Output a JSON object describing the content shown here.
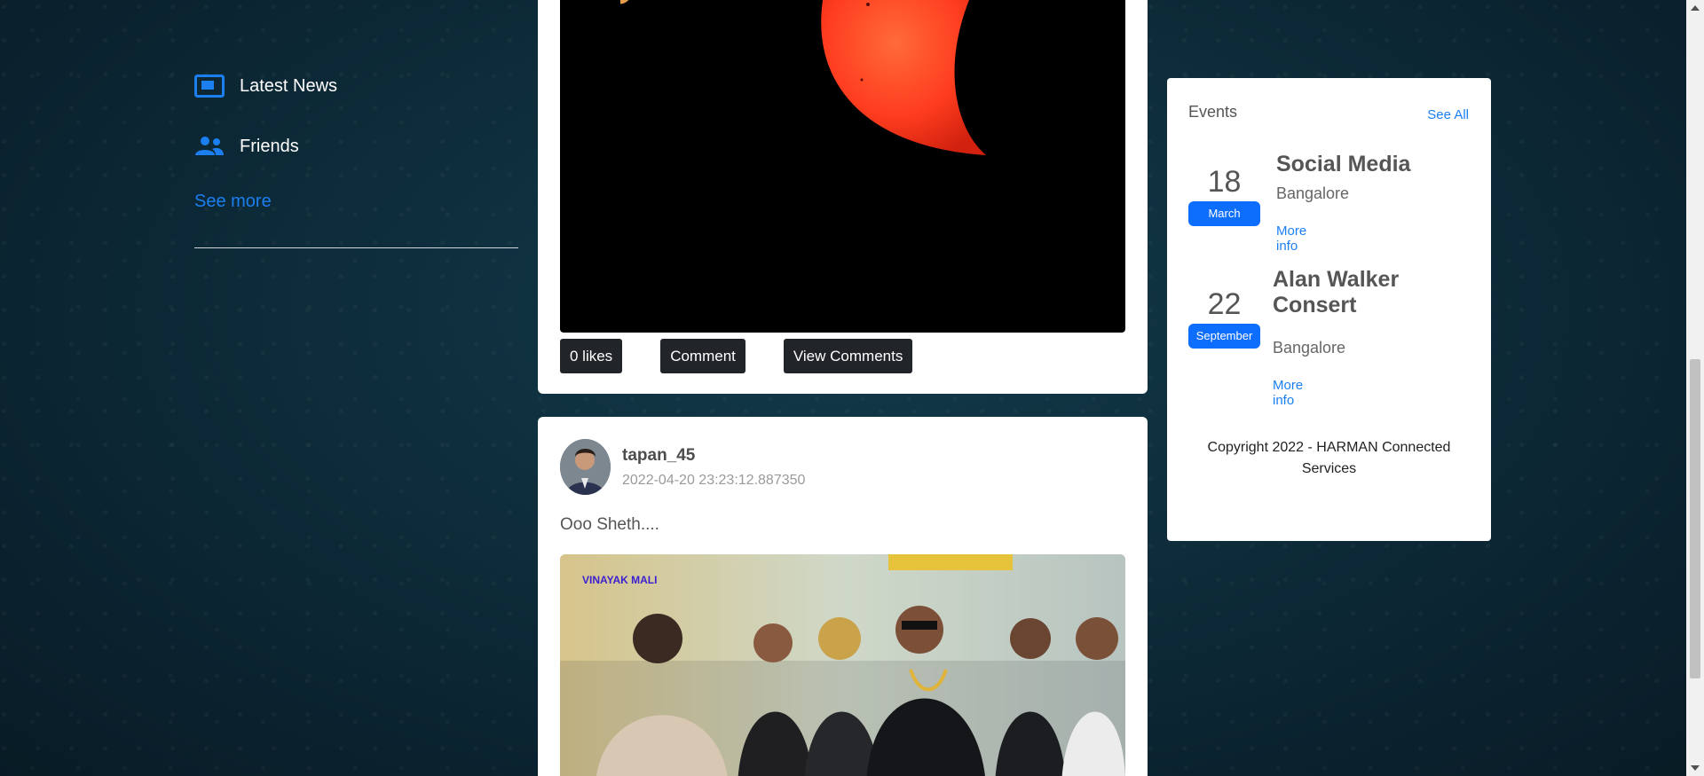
{
  "sidebar": {
    "items": [
      {
        "label": "Latest News",
        "icon": "newspaper-icon"
      },
      {
        "label": "Friends",
        "icon": "friends-icon"
      }
    ],
    "see_more": "See more"
  },
  "feed": {
    "previous_post": {
      "likes_label": "0 likes",
      "comment_label": "Comment",
      "view_comments_label": "View Comments"
    },
    "post": {
      "username": "tapan_45",
      "timestamp": "2022-04-20 23:23:12.887350",
      "text": "Ooo Sheth....",
      "image_caption": "VINAYAK MALI"
    }
  },
  "events": {
    "title": "Events",
    "see_all": "See All",
    "items": [
      {
        "day": "18",
        "month": "March",
        "title": "Social Media",
        "location": "Bangalore",
        "more_info": "More info"
      },
      {
        "day": "22",
        "month": "September",
        "title": "Alan Walker Consert",
        "location": "Bangalore",
        "more_info": "More info"
      }
    ],
    "copyright": "Copyright 2022 - HARMAN Connected Services"
  },
  "colors": {
    "accent": "#1c7ff0",
    "date_badge": "#0d6efd",
    "dark_button": "#212529",
    "page_background": "#0d2c3a"
  }
}
